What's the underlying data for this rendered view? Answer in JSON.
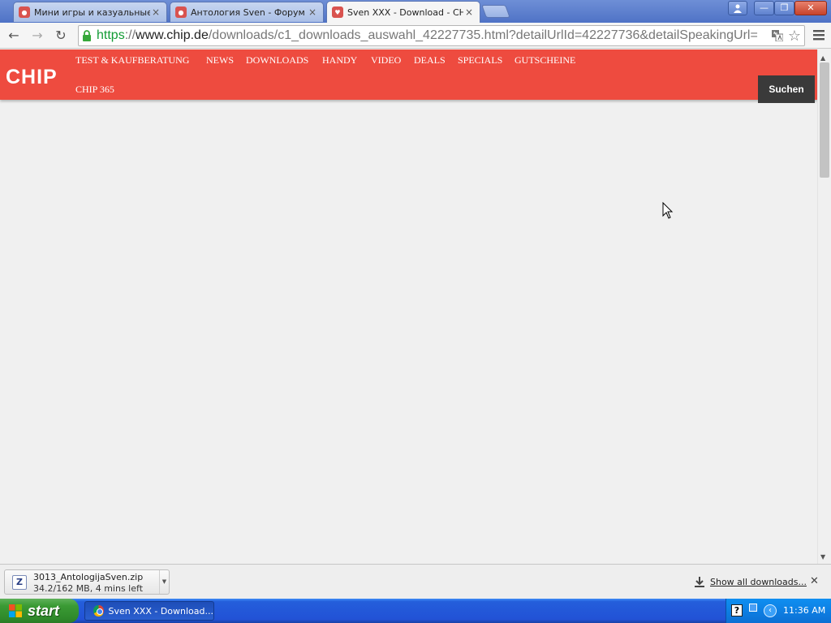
{
  "tabs": [
    {
      "title": "Мини игры и казуальные и",
      "close": "×",
      "active": false
    },
    {
      "title": "Антология Sven - Форум о",
      "close": "×",
      "active": false
    },
    {
      "title": "Sven XXX - Download - CHIP",
      "close": "×",
      "active": true
    }
  ],
  "window_controls": {
    "minimize": "—",
    "restore": "❐",
    "close": "✕"
  },
  "toolbar": {
    "back": "←",
    "forward": "→",
    "reload": "↻",
    "url_scheme": "https",
    "url_sep": "://",
    "url_host": "www.chip.de",
    "url_path": "/downloads/c1_downloads_auswahl_42227735.html?detailUrlId=42227736&detailSpeakingUrl=",
    "star": "☆"
  },
  "page": {
    "logo": "CHIP",
    "nav": [
      "TEST & KAUFBERATUNG",
      "NEWS",
      "DOWNLOADS",
      "HANDY",
      "VIDEO",
      "DEALS",
      "SPECIALS",
      "GUTSCHEINE"
    ],
    "nav_second_row": "CHIP 365",
    "search_label": "Suchen",
    "header_color": "#ee4b3f"
  },
  "scrollbar": {
    "up": "▲",
    "down": "▼"
  },
  "downloads": {
    "filename": "3013_AntologijaSven.zip",
    "status": "34.2/162 MB, 4 mins left",
    "icon_letter": "Z",
    "menu": "▼",
    "show_all": "Show all downloads...",
    "close": "✕"
  },
  "taskbar": {
    "start_label": "start",
    "task_label": "Sven XXX - Download...",
    "help_glyph": "?",
    "chevron": "‹",
    "clock": "11:36 AM"
  }
}
